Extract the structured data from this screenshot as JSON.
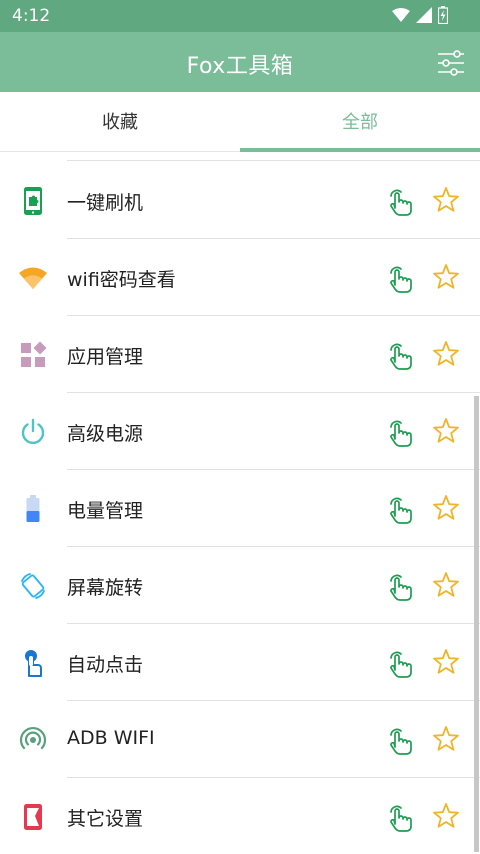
{
  "status_bar": {
    "time": "4:12"
  },
  "app_bar": {
    "title": "Fox工具箱"
  },
  "tabs": [
    {
      "label": "收藏",
      "selected": false
    },
    {
      "label": "全部",
      "selected": true
    }
  ],
  "colors": {
    "primary": "#7bbd98",
    "status_bar": "#5fa880",
    "tap_icon": "#1e9e52",
    "star": "#f0b429"
  },
  "items": [
    {
      "label": "一键刷机",
      "icon": "phone-puzzle-icon",
      "icon_color": "#1e9e52"
    },
    {
      "label": "wifi密码查看",
      "icon": "wifi-icon",
      "icon_color": "#f5a623"
    },
    {
      "label": "应用管理",
      "icon": "apps-grid-icon",
      "icon_color": "#c69bbc"
    },
    {
      "label": "高级电源",
      "icon": "power-icon",
      "icon_color": "#4fc3c7"
    },
    {
      "label": "电量管理",
      "icon": "battery-icon",
      "icon_color": "#4285f4"
    },
    {
      "label": "屏幕旋转",
      "icon": "screen-rotation-icon",
      "icon_color": "#29b6f6"
    },
    {
      "label": "自动点击",
      "icon": "auto-click-icon",
      "icon_color": "#1976d2"
    },
    {
      "label": "ADB WIFI",
      "icon": "adb-signal-icon",
      "icon_color": "#5aa07c"
    },
    {
      "label": "其它设置",
      "icon": "other-settings-icon",
      "icon_color": "#e53950"
    }
  ]
}
